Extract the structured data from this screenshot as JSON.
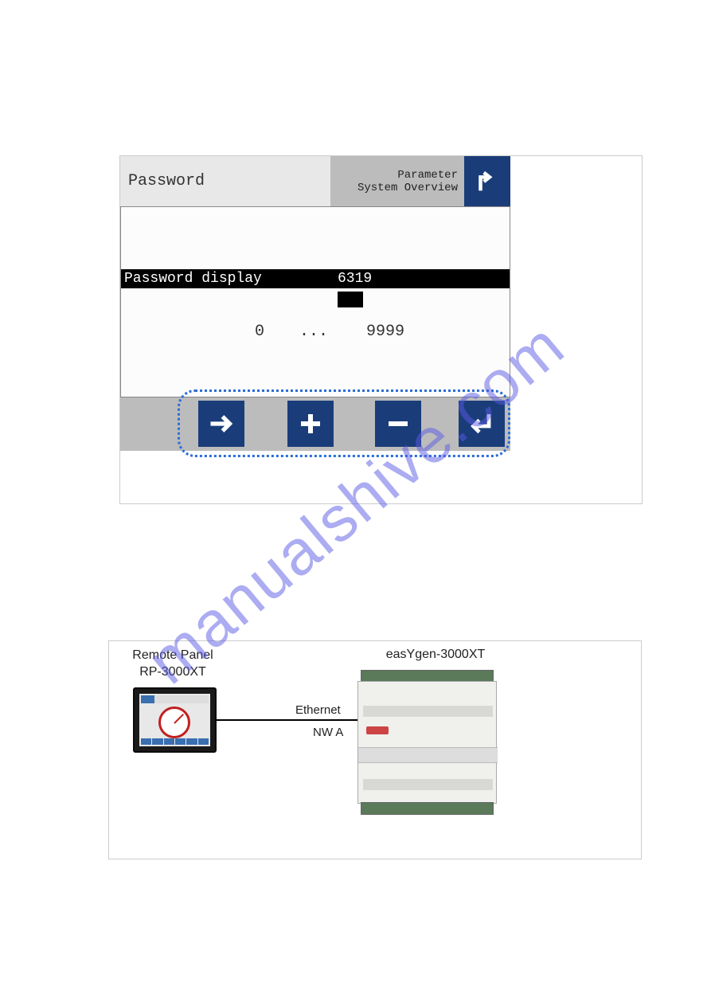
{
  "watermark": "manualshive.com",
  "figure1": {
    "title": "Password",
    "breadcrumb_line1": "Parameter",
    "breadcrumb_line2": "System Overview",
    "selected_row_label": "Password display",
    "selected_row_value": "6319",
    "range_min": "0",
    "range_dots": "...",
    "range_max": "9999",
    "buttons": {
      "back": "back-up-arrow",
      "right": "arrow-right",
      "plus": "plus",
      "minus": "minus",
      "enter": "enter"
    }
  },
  "figure2": {
    "remote_panel_label_line1": "Remote Panel",
    "remote_panel_label_line2": "RP-3000XT",
    "device_label": "easYgen-3000XT",
    "connection_label": "Ethernet",
    "network_label": "NW A"
  }
}
